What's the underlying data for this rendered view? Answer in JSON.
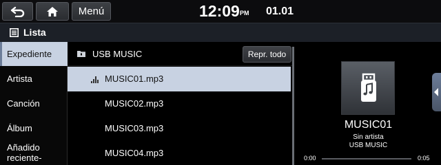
{
  "header": {
    "menu_label": "Menú",
    "time": "12:09",
    "ampm": "PM",
    "date": "01.01",
    "back_icon": "back-arrow-icon",
    "home_icon": "home-icon"
  },
  "title": "Lista",
  "categories": [
    {
      "label": "Expediente",
      "active": true
    },
    {
      "label": "Artista",
      "active": false
    },
    {
      "label": "Canción",
      "active": false
    },
    {
      "label": "Álbum",
      "active": false
    },
    {
      "label": "Añadido\nreciente-",
      "active": false
    }
  ],
  "folder": {
    "name": "USB MUSIC",
    "play_all_label": "Repr. todo"
  },
  "files": [
    {
      "name": "MUSIC01.mp3",
      "playing": true
    },
    {
      "name": "MUSIC02.mp3",
      "playing": false
    },
    {
      "name": "MUSIC03.mp3",
      "playing": false
    },
    {
      "name": "MUSIC04.mp3",
      "playing": false
    }
  ],
  "now_playing": {
    "title": "MUSIC01",
    "artist": "Sin artista",
    "album": "USB MUSIC",
    "elapsed": "0:00",
    "duration": "0:05",
    "progress_fraction": 0.0
  },
  "colors": {
    "accent": "#c8d2e2",
    "handle": "#6c7d99"
  }
}
